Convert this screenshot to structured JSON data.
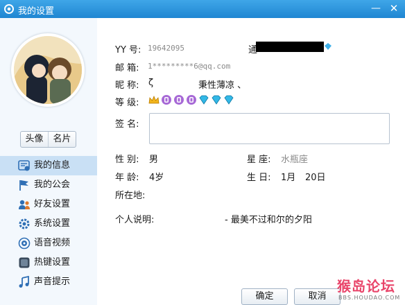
{
  "window": {
    "title": "我的设置",
    "minimize": "—",
    "close": "✕"
  },
  "sidebar": {
    "avatar_button": "头像",
    "card_button": "名片",
    "items": [
      {
        "label": "我的信息",
        "icon": "profile-card-icon",
        "active": true
      },
      {
        "label": "我的公会",
        "icon": "flag-icon"
      },
      {
        "label": "好友设置",
        "icon": "friends-icon"
      },
      {
        "label": "系统设置",
        "icon": "gear-icon"
      },
      {
        "label": "语音视频",
        "icon": "headset-icon"
      },
      {
        "label": "热键设置",
        "icon": "keyboard-icon"
      },
      {
        "label": "声音提示",
        "icon": "music-note-icon"
      }
    ]
  },
  "profile": {
    "yy_label": "YY  号:",
    "yy_value": "19642095",
    "verify_prefix": "通",
    "email_label": "邮  箱:",
    "email_value": "1*********6@qq.com",
    "nickname_label": "昵  称:",
    "nickname_prefix": "ζ",
    "nickname_main": "秉性薄凉  、",
    "level_label": "等  级:",
    "level_badges": [
      "crown",
      "moon",
      "moon",
      "moon",
      "diamond",
      "diamond",
      "diamond"
    ],
    "signature_label": "签  名:",
    "signature_value": "",
    "gender_label": "性  别:",
    "gender_value": "男",
    "constellation_label": "星  座:",
    "constellation_value": "水瓶座",
    "age_label": "年  龄:",
    "age_value": "4岁",
    "birthday_label": "生  日:",
    "birthday_month": "1月",
    "birthday_day": "20日",
    "location_label": "所在地:",
    "bio_label": "个人说明:",
    "bio_value": "- 最美不过和尔的夕阳"
  },
  "footer": {
    "ok": "确定",
    "cancel": "取消"
  },
  "watermark": {
    "text": "猴岛论坛",
    "url": "BBS.HOUDAO.COM"
  },
  "colors": {
    "title_bar": "#1f86d2",
    "active_nav": "#c9e0f5",
    "sidebar_bg": "#f3f8fd"
  }
}
